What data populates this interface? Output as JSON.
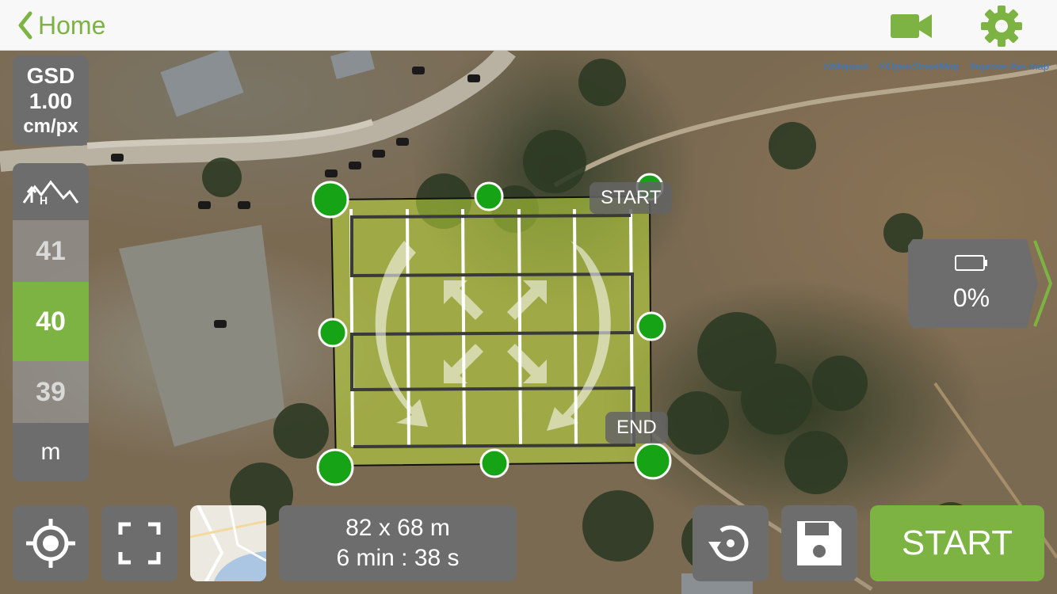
{
  "topbar": {
    "back_label": "Home",
    "icons": [
      "chevron-left-icon",
      "video-camera-icon",
      "gear-icon"
    ]
  },
  "map": {
    "attribution": [
      "©Mapbox",
      "©OpenStreetMap",
      "Improve this map"
    ],
    "start_label": "START",
    "end_label": "END"
  },
  "gsd": {
    "title": "GSD",
    "value": "1.00",
    "unit": "cm/px"
  },
  "altitude": {
    "options": [
      "41",
      "40",
      "39"
    ],
    "selected": "40",
    "unit": "m"
  },
  "battery": {
    "percent": "0%"
  },
  "info": {
    "area": "82 x 68 m",
    "duration": "6 min : 38 s"
  },
  "buttons": {
    "start": "START"
  },
  "colors": {
    "accent": "#7cb342",
    "panel": "#6d6d6d",
    "waypoint": "#17a316"
  }
}
